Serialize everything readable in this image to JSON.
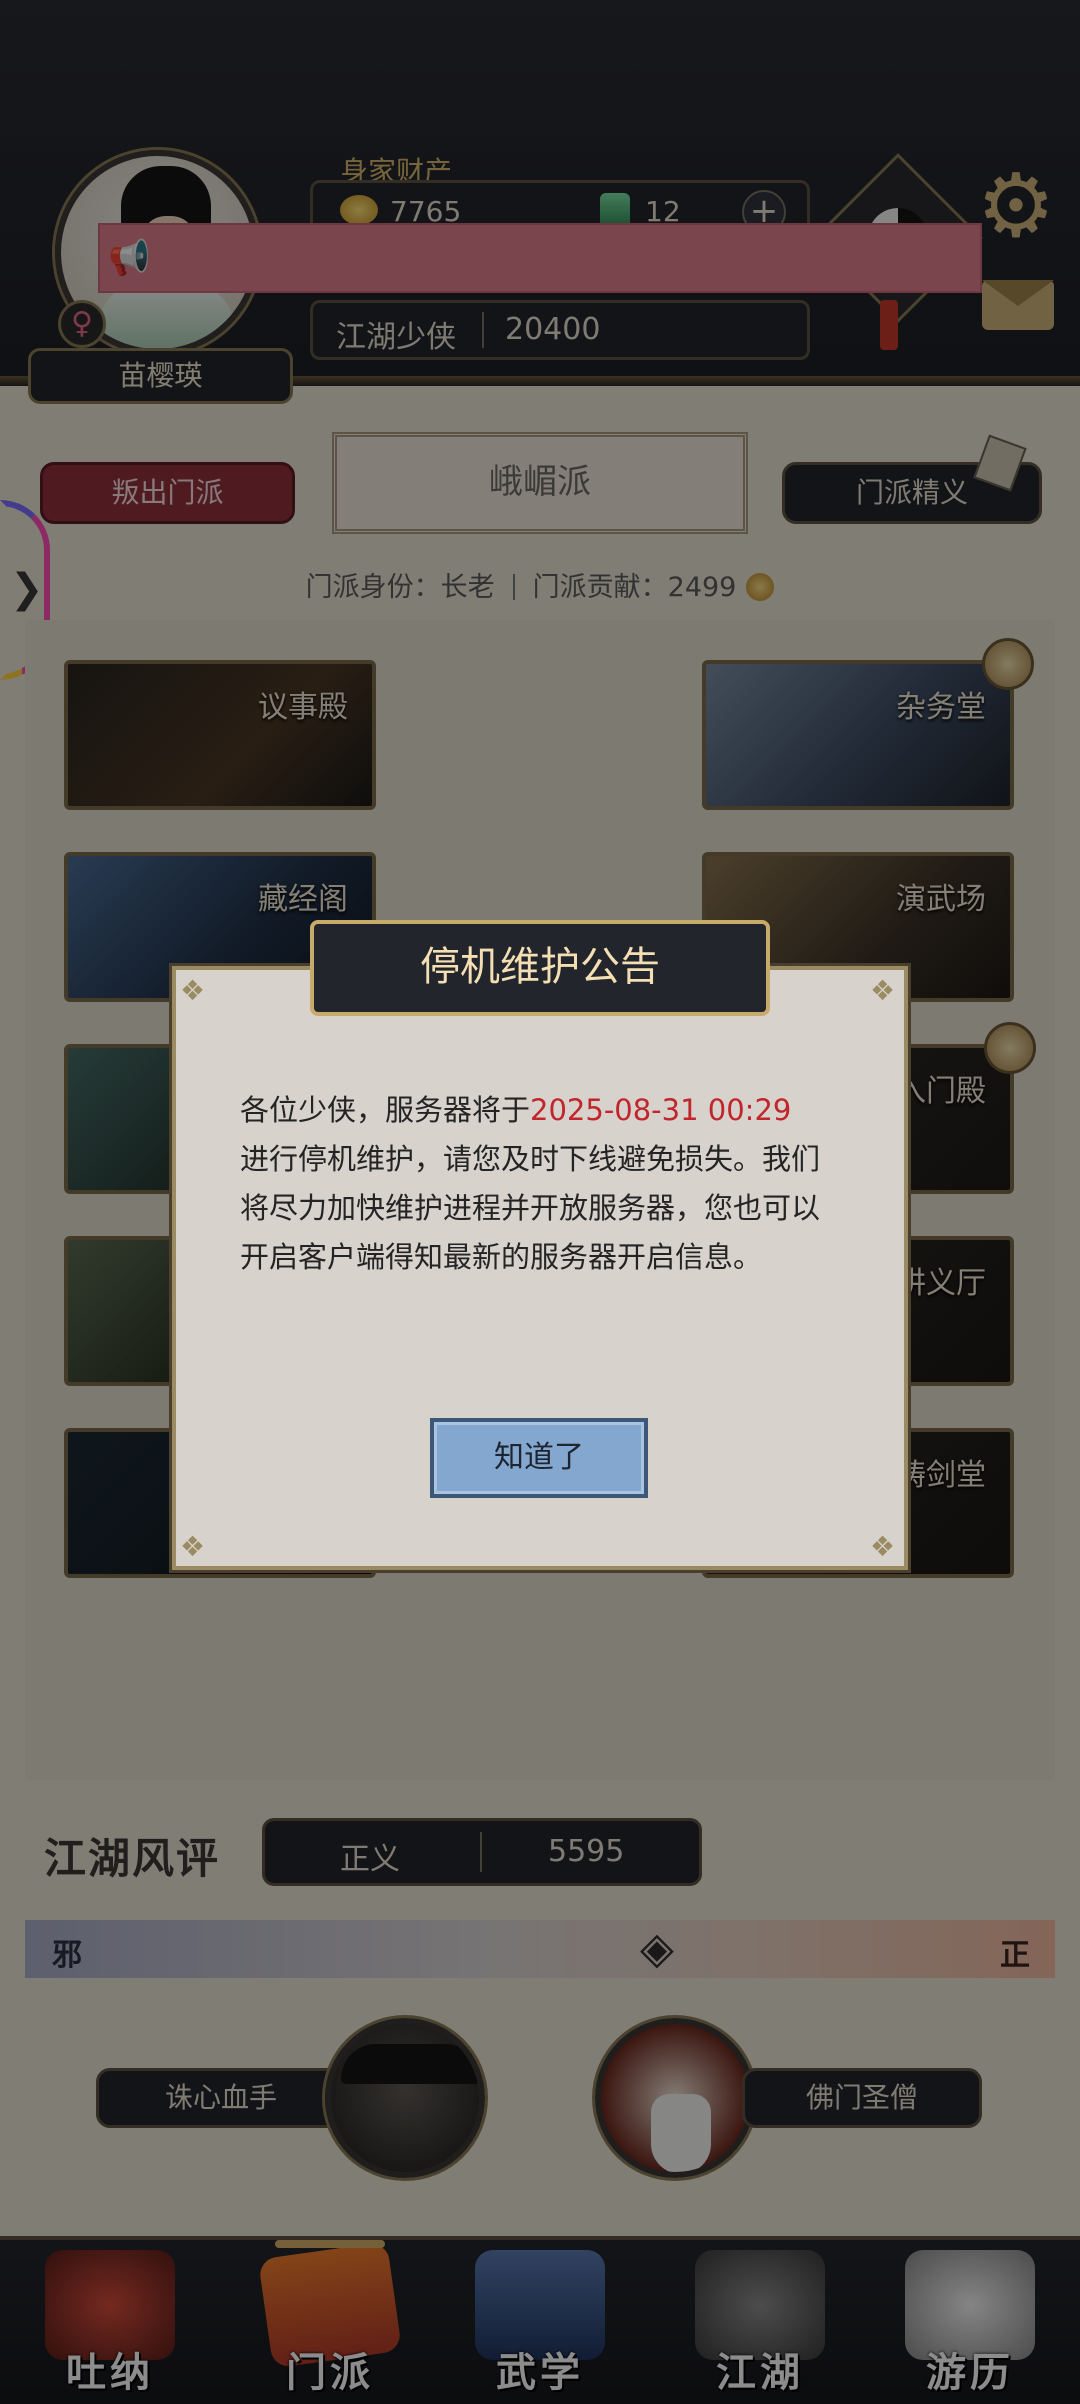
{
  "header": {
    "player_name": "苗樱瑛",
    "wealth_title": "身家财产",
    "gold_amount": "7765",
    "jade_amount": "12",
    "add_symbol": "+",
    "rank_title": "江湖少侠",
    "rank_score": "20400",
    "gender_symbol": "♀"
  },
  "sect": {
    "leave_button": "叛出门派",
    "sect_name": "峨嵋派",
    "essence_button": "门派精义",
    "identity_label": "门派身份：",
    "identity_value": "长老",
    "contribution_label": "门派贡献：",
    "contribution_value": "2499",
    "halls": [
      {
        "name": "议事殿"
      },
      {
        "name": "杂务堂"
      },
      {
        "name": "藏经阁"
      },
      {
        "name": "演武场"
      },
      {
        "name": "入门殿"
      },
      {
        "name": "讲义厅"
      },
      {
        "name": "铸剑堂"
      }
    ]
  },
  "reputation": {
    "title": "江湖风评",
    "label": "正义",
    "value": "5595",
    "left_end": "邪",
    "right_end": "正",
    "npc_left": "诛心血手",
    "npc_right": "佛门圣僧"
  },
  "nav": {
    "items": [
      {
        "label": "吐纳"
      },
      {
        "label": "门派"
      },
      {
        "label": "武学"
      },
      {
        "label": "江湖"
      },
      {
        "label": "游历"
      }
    ]
  },
  "modal": {
    "title": "停机维护公告",
    "text_before": "各位少侠，服务器将于",
    "highlight_time": "2025-08-31 00:29",
    "text_after": "进行停机维护，请您及时下线避免损失。我们将尽力加快维护进程并开放服务器，您也可以开启客户端得知最新的服务器开启信息。",
    "ok_button": "知道了"
  },
  "colors": {
    "announce_bar": "#e07f8f",
    "highlight_red": "#c0262b",
    "ok_button_blue": "#84a7cf"
  },
  "icons": [
    "megaphone-icon",
    "gear-icon",
    "mail-icon",
    "gold-icon",
    "jade-icon",
    "coin-icon"
  ]
}
